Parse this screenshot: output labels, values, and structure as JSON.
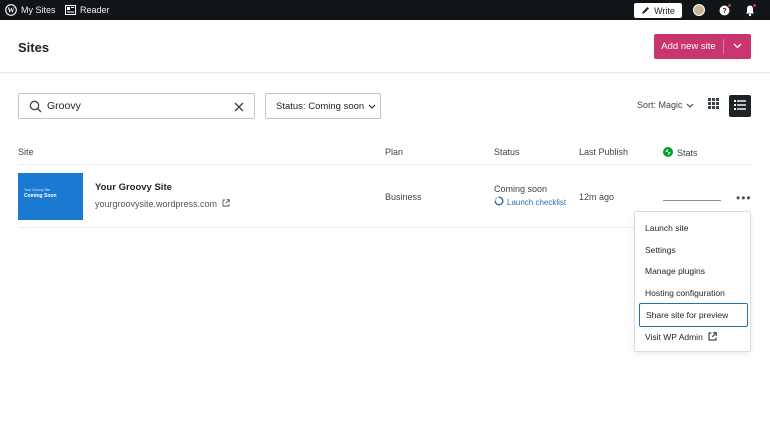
{
  "admin_bar": {
    "my_sites": "My Sites",
    "reader": "Reader",
    "write": "Write",
    "icons": [
      "wordpress-logo-icon",
      "reader-icon",
      "pencil-icon",
      "help-icon",
      "bell-icon"
    ]
  },
  "header": {
    "title": "Sites",
    "add_new": "Add new site"
  },
  "toolbar": {
    "search_value": "Groovy",
    "status_filter": "Status: Coming soon",
    "sort": "Sort: Magic"
  },
  "table": {
    "columns": [
      "Site",
      "Plan",
      "Status",
      "Last Publish",
      "Stats"
    ],
    "rows": [
      {
        "thumb_line1": "Your Groovy Site",
        "thumb_line2": "Coming Soon",
        "name": "Your Groovy Site",
        "url": "yourgroovysite.wordpress.com",
        "plan": "Business",
        "status": "Coming soon",
        "launch": "Launch checklist",
        "last_publish": "12m ago"
      }
    ]
  },
  "menu": {
    "items": [
      "Launch site",
      "Settings",
      "Manage plugins",
      "Hosting configuration",
      "Share site for preview",
      "Visit WP Admin"
    ],
    "focused_index": 4
  },
  "colors": {
    "accent": "#c9356e",
    "admin_bar": "#101517",
    "link": "#2271b1",
    "thumb": "#1a79d1",
    "stats": "#00a32a"
  }
}
